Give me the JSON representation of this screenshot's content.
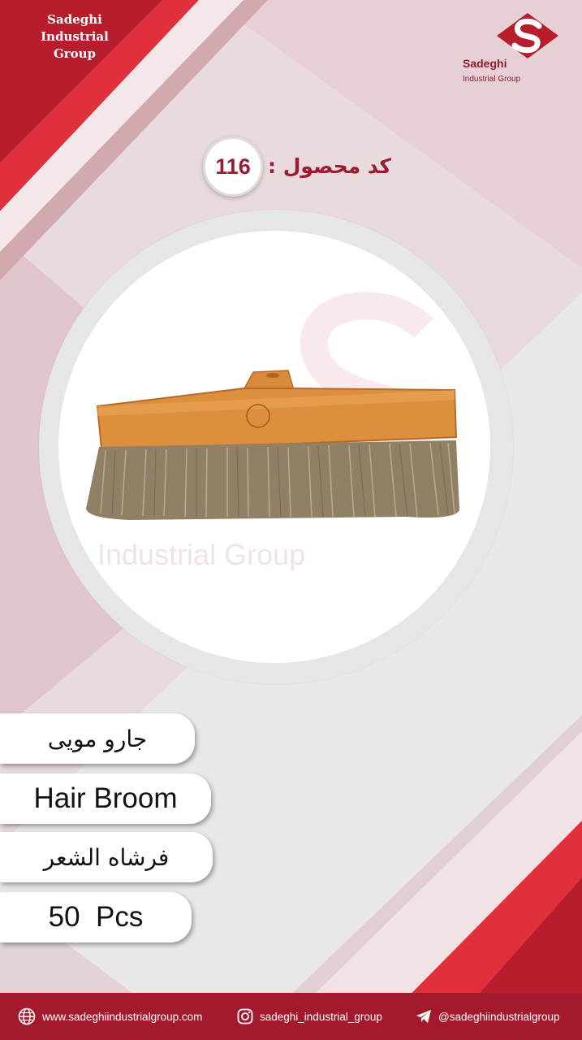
{
  "brand": {
    "name_line1": "Sadeghi",
    "name_line2": "Industrial Group",
    "logo_name": "Sadeghi",
    "logo_sub": "Industrial Group",
    "watermark": "Industrial Group"
  },
  "product": {
    "code_label": "کد محصول :",
    "code": "116",
    "image_icon": "hair-broom",
    "name_fa": "جارو مویی",
    "name_en": "Hair Broom",
    "name_ar": "فرشاه الشعر",
    "quantity": "50  Pcs"
  },
  "footer": {
    "website_icon": "globe-icon",
    "website": "www.sadeghiindustrialgroup.com",
    "instagram_icon": "instagram-icon",
    "instagram": "sadeghi_industrial_group",
    "telegram_icon": "telegram-icon",
    "telegram": "@sadeghiindustrialgroup"
  },
  "colors": {
    "accent": "#a41a2c",
    "accent_light": "#e0303c",
    "background": "#e9e7e8"
  }
}
